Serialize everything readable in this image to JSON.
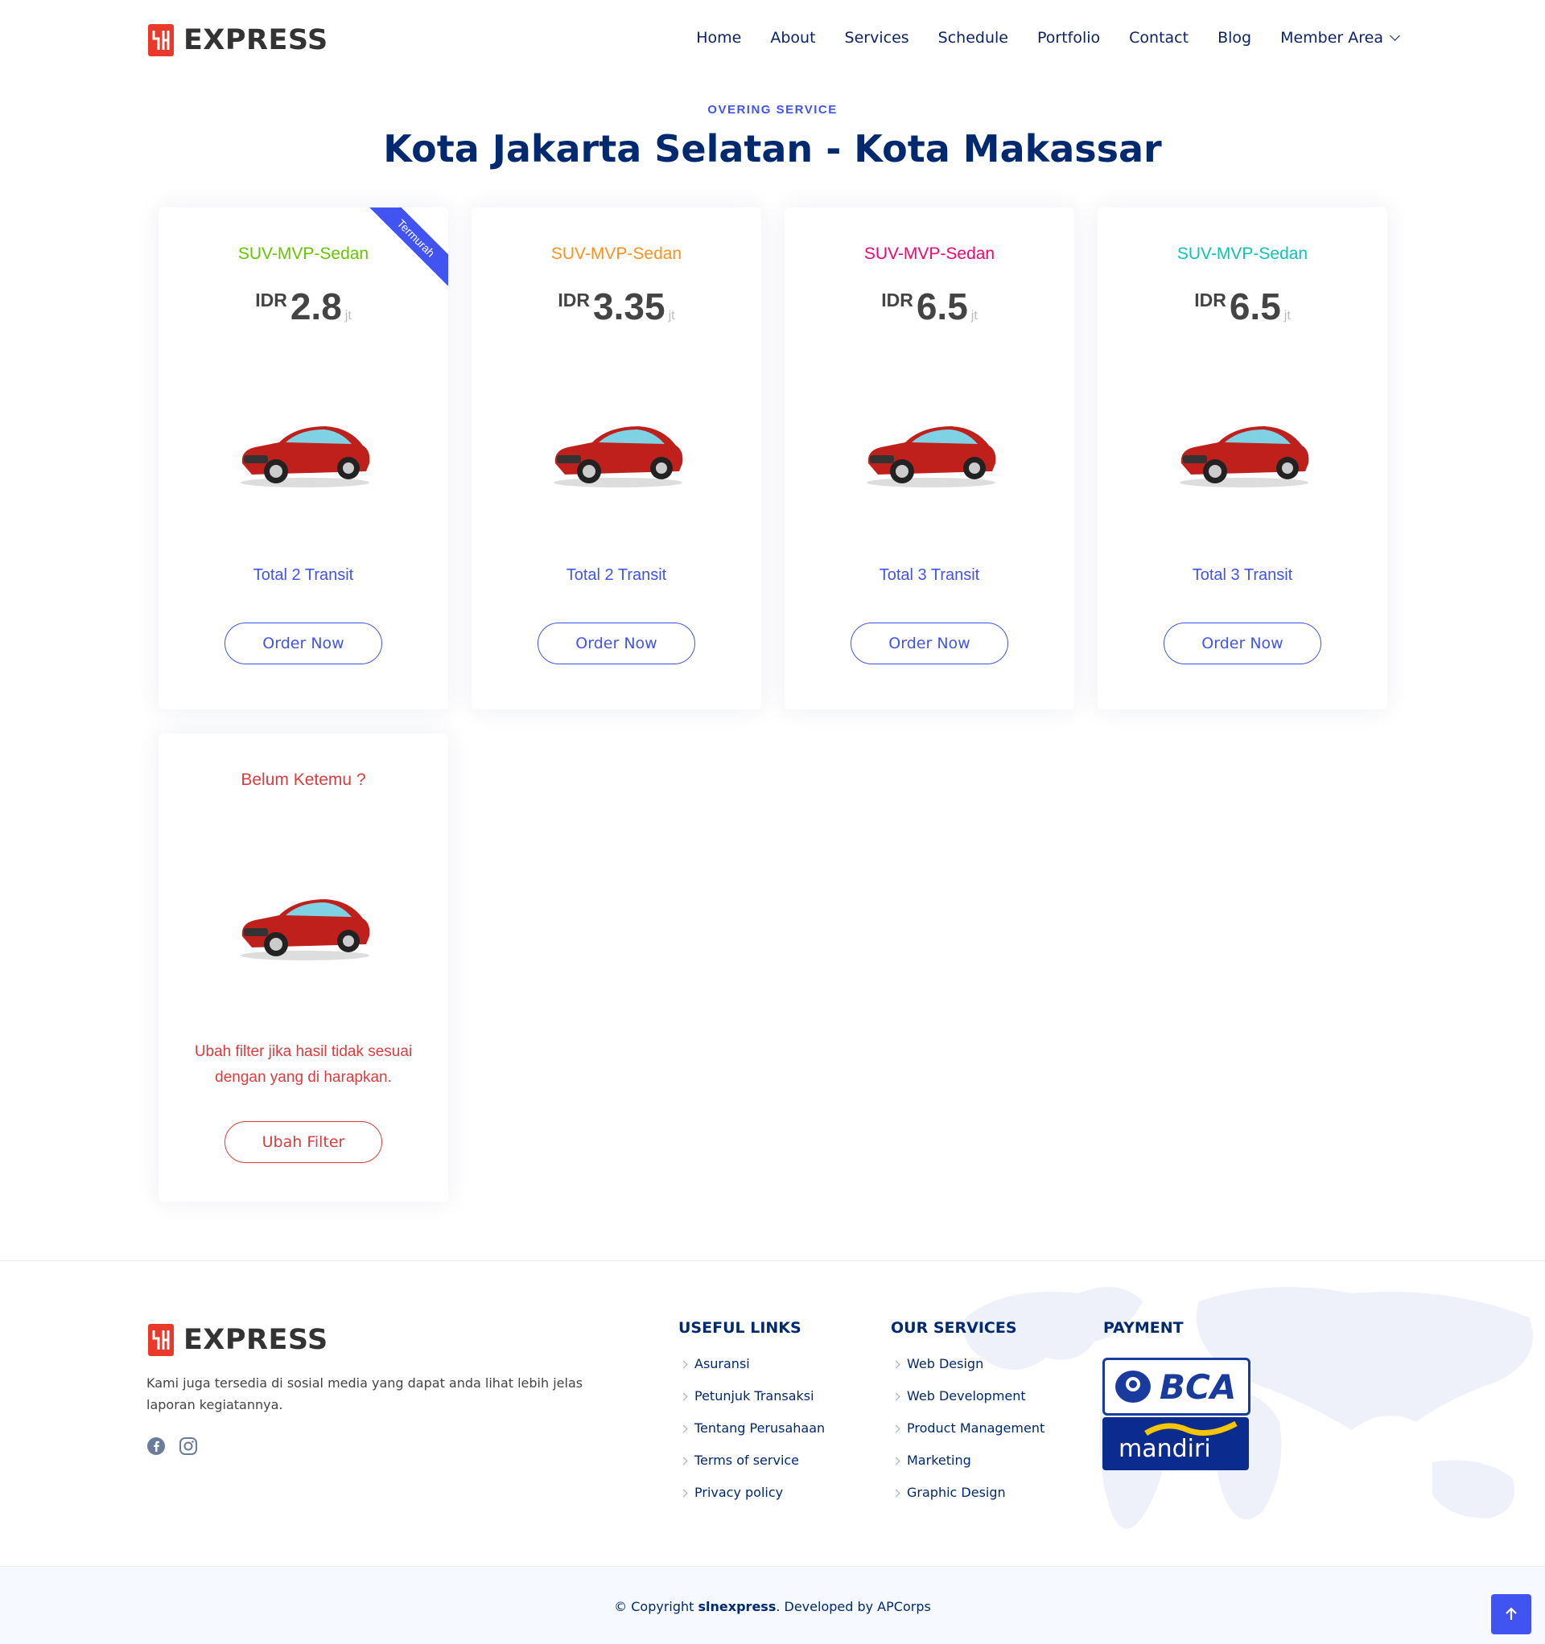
{
  "header": {
    "logo_text": "EXPRESS",
    "nav": [
      "Home",
      "About",
      "Services",
      "Schedule",
      "Portfolio",
      "Contact",
      "Blog",
      "Member Area"
    ]
  },
  "section": {
    "eyebrow": "OVERING SERVICE",
    "title": "Kota Jakarta Selatan - Kota Makassar"
  },
  "cards": [
    {
      "title": "SUV-MVP-Sedan",
      "title_color": "#65c600",
      "currency": "IDR",
      "amount": "2.8",
      "unit": "jt",
      "transit": "Total 2 Transit",
      "button": "Order Now",
      "ribbon": "Termurah"
    },
    {
      "title": "SUV-MVP-Sedan",
      "title_color": "#ff901c",
      "currency": "IDR",
      "amount": "3.35",
      "unit": "jt",
      "transit": "Total 2 Transit",
      "button": "Order Now"
    },
    {
      "title": "SUV-MVP-Sedan",
      "title_color": "#ff0071",
      "currency": "IDR",
      "amount": "6.5",
      "unit": "jt",
      "transit": "Total 3 Transit",
      "button": "Order Now"
    },
    {
      "title": "SUV-MVP-Sedan",
      "title_color": "#0cc4b1",
      "currency": "IDR",
      "amount": "6.5",
      "unit": "jt",
      "transit": "Total 3 Transit",
      "button": "Order Now"
    }
  ],
  "not_found": {
    "title": "Belum Ketemu ?",
    "message": "Ubah filter jika hasil tidak sesuai dengan yang di harapkan.",
    "button": "Ubah Filter",
    "color": "#e03a3c"
  },
  "footer": {
    "logo_text": "EXPRESS",
    "description": "Kami juga tersedia di sosial media yang dapat anda lihat lebih jelas laporan kegiatannya.",
    "useful_links_title": "USEFUL LINKS",
    "useful_links": [
      "Asuransi",
      "Petunjuk Transaksi",
      "Tentang Perusahaan",
      "Terms of service",
      "Privacy policy"
    ],
    "services_title": "OUR SERVICES",
    "services": [
      "Web Design",
      "Web Development",
      "Product Management",
      "Marketing",
      "Graphic Design"
    ],
    "payment_title": "PAYMENT",
    "payment_bca": "BCA",
    "payment_mandiri": "mandiri"
  },
  "copyright": {
    "prefix": "© Copyright ",
    "brand": "slnexpress",
    "suffix": ". Developed by APCorps"
  },
  "colors": {
    "accent": "#4154f1",
    "navy": "#012970"
  }
}
